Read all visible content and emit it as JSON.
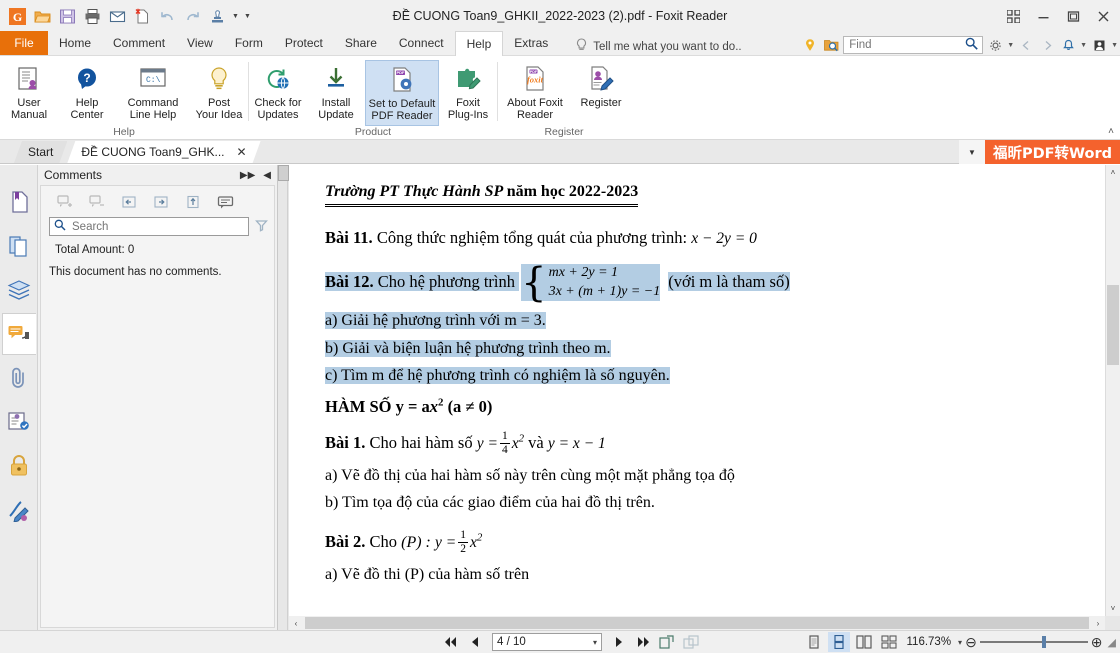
{
  "window": {
    "title": "ĐỀ CUONG Toan9_GHKII_2022-2023  (2).pdf - Foxit Reader",
    "controls": {
      "grid": "⊞",
      "minimize": "▭",
      "maximize": "❐",
      "close": "✕"
    }
  },
  "quick_access": [
    {
      "name": "foxit-logo-icon",
      "glyph": "G"
    },
    {
      "name": "open-icon",
      "glyph": "open"
    },
    {
      "name": "save-icon",
      "glyph": "save"
    },
    {
      "name": "print-icon",
      "glyph": "print"
    },
    {
      "name": "email-icon",
      "glyph": "email"
    },
    {
      "name": "new-from-file-icon",
      "glyph": "newfile"
    },
    {
      "name": "undo-icon",
      "glyph": "undo"
    },
    {
      "name": "redo-icon",
      "glyph": "redo"
    },
    {
      "name": "stamp-icon",
      "glyph": "stamp"
    }
  ],
  "menu": {
    "file_label": "File",
    "tabs": [
      {
        "label": "Home",
        "active": false
      },
      {
        "label": "Comment",
        "active": false
      },
      {
        "label": "View",
        "active": false
      },
      {
        "label": "Form",
        "active": false
      },
      {
        "label": "Protect",
        "active": false
      },
      {
        "label": "Share",
        "active": false
      },
      {
        "label": "Connect",
        "active": false
      },
      {
        "label": "Help",
        "active": true
      },
      {
        "label": "Extras",
        "active": false
      }
    ],
    "tell_me": "Tell me what you want to do..",
    "find_placeholder": "Find"
  },
  "ribbon": {
    "groups": [
      {
        "label": "Help",
        "buttons": [
          {
            "name": "user-manual-button",
            "line1": "User",
            "line2": "Manual",
            "icon": "manual-icon",
            "selected": false
          },
          {
            "name": "help-center-button",
            "line1": "Help",
            "line2": "Center",
            "icon": "question-bubble-icon",
            "selected": false
          },
          {
            "name": "command-line-help-button",
            "line1": "Command",
            "line2": "Line Help",
            "icon": "console-icon",
            "selected": false
          },
          {
            "name": "post-your-idea-button",
            "line1": "Post",
            "line2": "Your Idea",
            "icon": "lightbulb-icon",
            "selected": false
          }
        ]
      },
      {
        "label": "Product",
        "buttons": [
          {
            "name": "check-for-updates-button",
            "line1": "Check for",
            "line2": "Updates",
            "icon": "refresh-globe-icon",
            "selected": false
          },
          {
            "name": "install-update-button",
            "line1": "Install",
            "line2": "Update",
            "icon": "download-icon",
            "selected": false
          },
          {
            "name": "set-to-default-pdf-reader-button",
            "line1": "Set to Default",
            "line2": "PDF Reader",
            "icon": "pdf-gear-icon",
            "selected": true
          },
          {
            "name": "foxit-plug-ins-button",
            "line1": "Foxit",
            "line2": "Plug-Ins",
            "icon": "puzzle-pencil-icon",
            "selected": false
          }
        ]
      },
      {
        "label": "Register",
        "buttons": [
          {
            "name": "about-foxit-reader-button",
            "line1": "About Foxit",
            "line2": "Reader",
            "icon": "foxit-doc-icon",
            "selected": false
          },
          {
            "name": "register-button",
            "line1": "Register",
            "line2": "",
            "icon": "user-pencil-icon",
            "selected": false
          }
        ]
      }
    ]
  },
  "doc_tabs": {
    "tabs": [
      {
        "label": "Start",
        "active": false,
        "closable": false
      },
      {
        "label": "ĐỀ CUONG Toan9_GHK...",
        "active": true,
        "closable": true,
        "close_glyph": "✕"
      }
    ],
    "promo": "福昕PDF转Word",
    "dropdown_glyph": "▼"
  },
  "rail": [
    {
      "name": "sidebar-item-bookmarks",
      "icon": "bookmark-page-icon",
      "active": false
    },
    {
      "name": "sidebar-item-page-thumbnails",
      "icon": "pages-icon",
      "active": false
    },
    {
      "name": "sidebar-item-layers",
      "icon": "layers-icon",
      "active": false
    },
    {
      "name": "sidebar-item-comments",
      "icon": "comment-icon",
      "active": true
    },
    {
      "name": "sidebar-item-attachments",
      "icon": "paperclip-icon",
      "active": false
    },
    {
      "name": "sidebar-item-review",
      "icon": "document-check-icon",
      "active": false
    },
    {
      "name": "sidebar-item-security",
      "icon": "lock-icon",
      "active": false
    },
    {
      "name": "sidebar-item-signatures",
      "icon": "signature-pen-icon",
      "active": false
    }
  ],
  "comments_panel": {
    "title": "Comments",
    "expand_glyph": "▶▶",
    "collapse_glyph": "◀",
    "tools": [
      {
        "name": "expand-all-comments-icon",
        "glyph": "expand-all"
      },
      {
        "name": "collapse-all-comments-icon",
        "glyph": "collapse-all"
      },
      {
        "name": "previous-comment-icon",
        "glyph": "prev"
      },
      {
        "name": "next-comment-icon",
        "glyph": "next"
      },
      {
        "name": "sort-comments-icon",
        "glyph": "sort"
      },
      {
        "name": "reply-comment-icon",
        "glyph": "reply"
      }
    ],
    "search_placeholder": "Search",
    "search_value": "",
    "filter_icon": "filter-icon",
    "total_amount": "Total Amount: 0",
    "empty_message": "This document has no comments."
  },
  "document": {
    "header": {
      "school": "Trường PT Thực Hành SP ",
      "year": "năm học 2022-2023"
    },
    "blocks": [
      {
        "id": "bai11",
        "label": "Bài 11.",
        "text": " Công thức nghiệm tổng quát của phương trình: ",
        "math": "x − 2y = 0",
        "highlight": false
      },
      {
        "id": "bai12",
        "label": "Bài 12.",
        "text": " Cho hệ phương trình ",
        "eq1": "mx + 2y = 1",
        "eq2": "3x + (m + 1)y = −1",
        "note": "(với m là tham số)",
        "highlight": true
      },
      {
        "id": "bai12a",
        "text": "a) Giải hệ phương trình với m = 3.",
        "highlight": true
      },
      {
        "id": "bai12b",
        "text": "b) Giải và biện luận hệ phương trình theo m.",
        "highlight": true
      },
      {
        "id": "bai12c",
        "text": "c) Tìm m để hệ phương trình có nghiệm là số nguyên.",
        "highlight": true
      }
    ],
    "section_title": {
      "pre": "HÀM SỐ y = a",
      "var": "x",
      "sup": "2",
      "post": " (a ≠ 0)"
    },
    "bai1": {
      "label": "Bài 1.",
      "text": " Cho hai hàm số ",
      "eq_lead": "y =",
      "frac_num": "1",
      "frac_den": "4",
      "eq_tail": "x",
      "eq_sup": "2",
      "conj": " và ",
      "eq2": "y = x − 1",
      "items": [
        "a)  Vẽ đồ thị của hai hàm số này trên cùng một mặt phẳng tọa độ",
        "b)  Tìm tọa độ của các giao điểm của hai đồ thị trên."
      ]
    },
    "bai2": {
      "label": "Bài 2.",
      "text": " Cho ",
      "paren": "(P) :",
      "eq_lead": "y =",
      "frac_num": "1",
      "frac_den": "2",
      "eq_tail": "x",
      "eq_sup": "2",
      "items": [
        "a)  Vẽ đồ thi (P) của hàm số trên"
      ]
    }
  },
  "status_bar": {
    "first_page": "⏮",
    "prev_page": "◀",
    "page_value": "4 / 10",
    "page_caret": "▾",
    "next_page": "▶",
    "last_page": "⏭",
    "buttons": [
      {
        "name": "fit-page-button",
        "icon": "fit-page-icon"
      },
      {
        "name": "rotate-view-button",
        "icon": "rotate-icon"
      }
    ],
    "view_modes": [
      {
        "name": "single-page-view-button",
        "icon": "single-page-icon",
        "selected": false
      },
      {
        "name": "continuous-view-button",
        "icon": "continuous-icon",
        "selected": true
      },
      {
        "name": "facing-view-button",
        "icon": "facing-icon",
        "selected": false
      },
      {
        "name": "facing-continuous-view-button",
        "icon": "facing-continuous-icon",
        "selected": false
      }
    ],
    "zoom_level": "116.73%",
    "zoom_caret": "▾",
    "zoom_out": "⊖",
    "zoom_in": "⊕",
    "resize_grip": "◢"
  },
  "colors": {
    "accent_orange": "#e8700a",
    "promo_orange": "#f4622d",
    "highlight_blue": "#b3cde3",
    "ribbon_selected": "#cfe0f3"
  }
}
